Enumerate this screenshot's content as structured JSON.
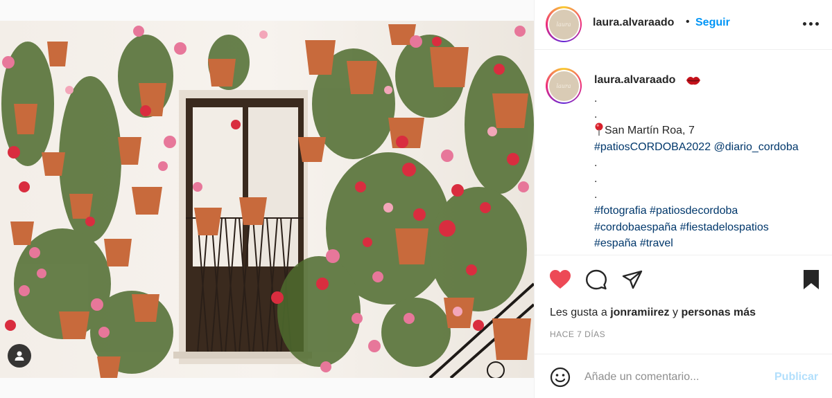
{
  "post": {
    "photo_icon": "person-tag-icon",
    "username": "laura.alvaraado",
    "follow_label": "Seguir",
    "dot": "•",
    "more_icon": "more-options-icon"
  },
  "caption": {
    "username": "laura.alvaraado",
    "user_emoji": "red-lips-emoji",
    "lines": [
      {
        "text": "."
      },
      {
        "text": "."
      },
      {
        "text": "San Martín Roa, 7",
        "icon": "round-pushpin-emoji"
      },
      {
        "text": "#patiosCORDOBA2022 @diario_cordoba"
      },
      {
        "text": "."
      },
      {
        "text": "."
      },
      {
        "text": "."
      },
      {
        "text": "#fotografia #patiosdecordoba"
      },
      {
        "text": "#cordobaespaña #fiestadelospatios"
      },
      {
        "text": "#españa #travel"
      }
    ]
  },
  "actions": {
    "like_icon": "heart-filled-icon",
    "comment_icon": "comment-icon",
    "share_icon": "share-paper-plane-icon",
    "save_icon": "bookmark-filled-icon",
    "liked_color": "#ed4956"
  },
  "likes": {
    "prefix": "Les gusta a",
    "user": "jonramiirez",
    "middle": "y",
    "suffix": "personas más"
  },
  "timestamp": "HACE 7 DÍAS",
  "comment": {
    "emoji_icon": "emoji-smile-icon",
    "placeholder": "Añade un comentario...",
    "publish_label": "Publicar"
  },
  "colors": {
    "link_blue": "#0095f6",
    "publish_disabled": "#b2dffc",
    "hashtag": "#00376b",
    "text": "#262626",
    "muted": "#8e8e8e"
  }
}
